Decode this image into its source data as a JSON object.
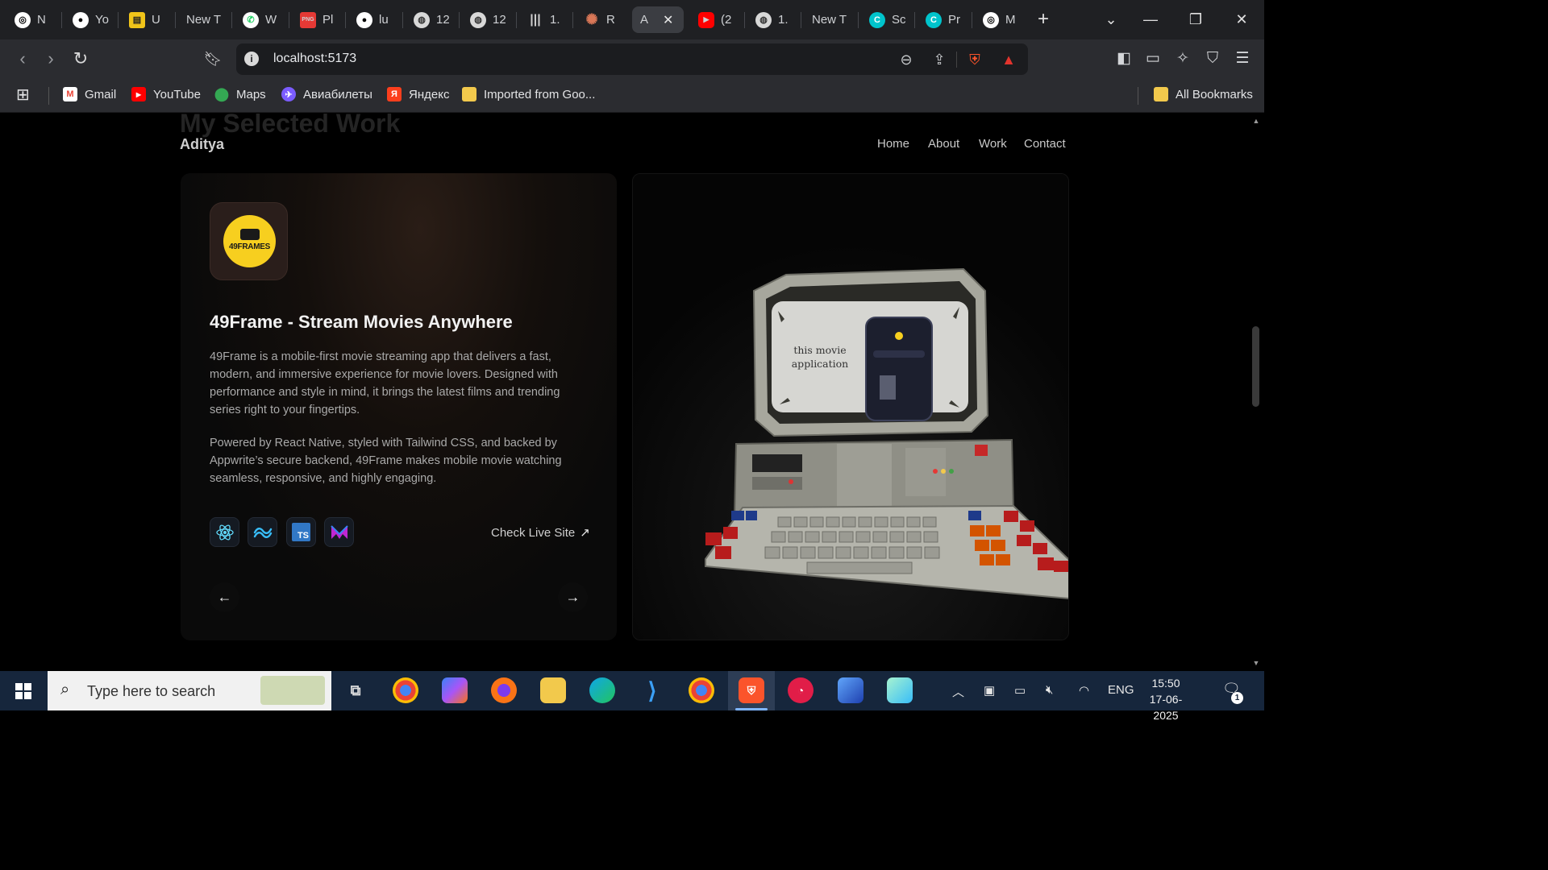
{
  "browser": {
    "tabs": [
      {
        "icon": "openai-icon",
        "label": "N",
        "color": "#ffffff"
      },
      {
        "icon": "github-icon",
        "label": "Yo",
        "color": "#ffffff"
      },
      {
        "icon": "udemy-icon",
        "label": "U",
        "color": "#f0c419"
      },
      {
        "icon": "blank-page-icon",
        "label": "New T",
        "color": "#888888"
      },
      {
        "icon": "whatsapp-icon",
        "label": "W",
        "color": "#25d366"
      },
      {
        "icon": "png-svg-icon",
        "label": "Pl",
        "color": "#e53935"
      },
      {
        "icon": "github-icon",
        "label": "lu",
        "color": "#ffffff"
      },
      {
        "icon": "globe-icon",
        "label": "12",
        "color": "#cccccc"
      },
      {
        "icon": "globe-icon",
        "label": "12",
        "color": "#cccccc"
      },
      {
        "icon": "stripes-icon",
        "label": "1.",
        "color": "#cccccc"
      },
      {
        "icon": "claude-icon",
        "label": "R",
        "color": "#d97757"
      },
      {
        "icon": "",
        "label": "A",
        "color": "#ffffff",
        "active": true
      },
      {
        "icon": "youtube-icon",
        "label": "(2",
        "color": "#ff0000"
      },
      {
        "icon": "globe-icon",
        "label": "1.",
        "color": "#cccccc"
      },
      {
        "icon": "blank-page-icon",
        "label": "New T",
        "color": "#888888"
      },
      {
        "icon": "canva-icon",
        "label": "Sc",
        "color": "#00c4cc"
      },
      {
        "icon": "canva-icon",
        "label": "Pr",
        "color": "#00c4cc"
      },
      {
        "icon": "openai-icon",
        "label": "M",
        "color": "#ffffff"
      }
    ],
    "url": "localhost:5173",
    "bookmarks": [
      {
        "icon": "gmail-icon",
        "label": "Gmail",
        "color": "#ea4335"
      },
      {
        "icon": "youtube-icon",
        "label": "YouTube",
        "color": "#ff0000"
      },
      {
        "icon": "maps-icon",
        "label": "Maps",
        "color": "#34a853"
      },
      {
        "icon": "aviasales-icon",
        "label": "Авиабилеты",
        "color": "#7b5cff"
      },
      {
        "icon": "yandex-icon",
        "label": "Яндекс",
        "color": "#fc3f1d"
      },
      {
        "icon": "folder-icon",
        "label": "Imported from Goo...",
        "color": "#f2c94c"
      }
    ],
    "all_bookmarks": "All Bookmarks"
  },
  "site": {
    "ghost_heading": "My Selected Work",
    "brand": "Aditya",
    "nav": [
      "Home",
      "About",
      "Work",
      "Contact"
    ],
    "project": {
      "logo_text": "49FRAMES",
      "title": "49Frame - Stream Movies Anywhere",
      "description_1": "49Frame is a mobile-first movie streaming app that delivers a fast, modern, and immersive experience for movie lovers. Designed with performance and style in mind, it brings the latest films and trending series right to your fingertips.",
      "description_2": "Powered by React Native, styled with Tailwind CSS, and backed by Appwrite’s secure backend, 49Frame makes mobile movie watching seamless, responsive, and highly engaging.",
      "tech_stack": [
        {
          "icon": "react-icon",
          "color": "#61dafb"
        },
        {
          "icon": "tailwind-icon",
          "color": "#38bdf8"
        },
        {
          "icon": "typescript-icon",
          "color": "#3178c6",
          "text": "TS"
        },
        {
          "icon": "motion-icon",
          "color": "#c026d3"
        }
      ],
      "live_link": "Check Live Site",
      "screen_text": "this movie application"
    }
  },
  "taskbar": {
    "search_placeholder": "Type here to search",
    "tray": {
      "language": "ENG",
      "time": "15:50",
      "date": "17-06-2025",
      "notifications": "1"
    },
    "colors": {
      "background": "#16263c",
      "accent": "#7fb5ff"
    }
  }
}
